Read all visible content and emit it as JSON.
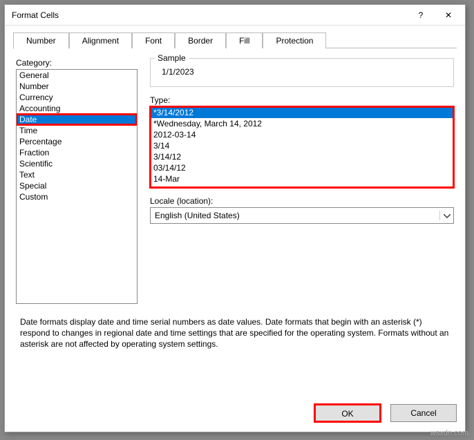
{
  "dialog": {
    "title": "Format Cells"
  },
  "tabs": [
    "Number",
    "Alignment",
    "Font",
    "Border",
    "Fill",
    "Protection"
  ],
  "activeTab": 0,
  "category": {
    "label": "Category:",
    "items": [
      "General",
      "Number",
      "Currency",
      "Accounting",
      "Date",
      "Time",
      "Percentage",
      "Fraction",
      "Scientific",
      "Text",
      "Special",
      "Custom"
    ],
    "selectedIndex": 4
  },
  "sample": {
    "label": "Sample",
    "value": "1/1/2023"
  },
  "type": {
    "label": "Type:",
    "items": [
      "*3/14/2012",
      "*Wednesday, March 14, 2012",
      "2012-03-14",
      "3/14",
      "3/14/12",
      "03/14/12",
      "14-Mar"
    ],
    "selectedIndex": 0
  },
  "locale": {
    "label": "Locale (location):",
    "value": "English (United States)"
  },
  "description": "Date formats display date and time serial numbers as date values.  Date formats that begin with an asterisk (*) respond to changes in regional date and time settings that are specified for the operating system. Formats without an asterisk are not affected by operating system settings.",
  "buttons": {
    "ok": "OK",
    "cancel": "Cancel"
  },
  "watermark": "wsxdn.com"
}
